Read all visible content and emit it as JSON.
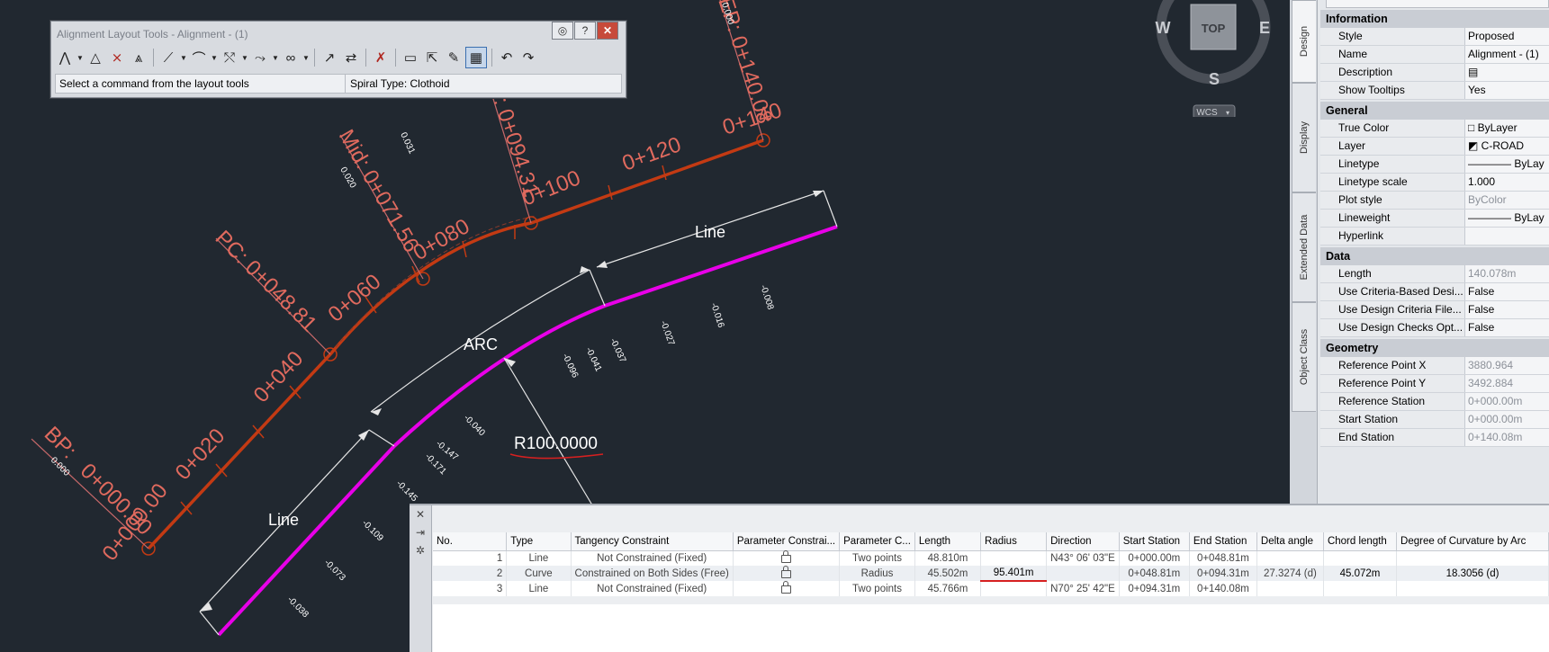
{
  "toolbar": {
    "title": "Alignment Layout Tools - Alignment - (1)",
    "status_left": "Select a command from the layout tools",
    "status_right": "Spiral Type: Clothoid",
    "close_glyph": "✕",
    "help_glyph": "?",
    "icons": [
      "pi-icon",
      "point-add-icon",
      "point-delete-icon",
      "pi-edit-icon",
      "line-tools-icon",
      "curve-tools-icon",
      "line-curve-icon",
      "spiral-tools-icon",
      "float-free-icon",
      "convert-icon",
      "reverse-icon",
      "delete-entity-icon",
      "edit-geometry-icon",
      "pick-entity-icon",
      "entity-editor-icon",
      "grid-view-icon",
      "undo-icon",
      "redo-icon"
    ]
  },
  "viewcube": {
    "top": "TOP",
    "west": "W",
    "east": "E",
    "south": "S",
    "wcs": "WCS"
  },
  "drawing": {
    "stations": {
      "s000": "0+000.00",
      "s020": "0+020",
      "s040": "0+040",
      "s060": "0+060",
      "s080": "0+080",
      "s100": "0+100",
      "s120": "0+120",
      "s140": "0+140"
    },
    "labels": {
      "bp": "BP:",
      "bp_sta": "0+000.00",
      "pc": "PC: 0+048.81",
      "mid": "Mid: 0+071.56",
      "pt": "PT: 0+094.31",
      "ep": "EP: 0+140.08",
      "line1": "Line",
      "arc": "ARC",
      "line2": "Line",
      "radius": "R100.0000"
    },
    "elev": [
      "0.000",
      "0.020",
      "0.031",
      "-0.038",
      "-0.073",
      "-0.109",
      "-0.145",
      "-0.171",
      "-0.147",
      "-0.040",
      "-0.096",
      "-0.041",
      "-0.037",
      "-0.027",
      "-0.016",
      "-0.008",
      "0.000"
    ]
  },
  "props": {
    "tabs": [
      "Design",
      "Display",
      "Extended Data",
      "Object Class"
    ],
    "sections": [
      {
        "name": "Information",
        "rows": [
          {
            "k": "Style",
            "v": "Proposed"
          },
          {
            "k": "Name",
            "v": "Alignment - (1)"
          },
          {
            "k": "Description",
            "v": "▤"
          },
          {
            "k": "Show Tooltips",
            "v": "Yes"
          }
        ]
      },
      {
        "name": "General",
        "rows": [
          {
            "k": "True Color",
            "v": "□ ByLayer"
          },
          {
            "k": "Layer",
            "v": "◩ C-ROAD"
          },
          {
            "k": "Linetype",
            "v": "———— ByLay"
          },
          {
            "k": "Linetype scale",
            "v": "1.000"
          },
          {
            "k": "Plot style",
            "v": "ByColor",
            "gray": true
          },
          {
            "k": "Lineweight",
            "v": "———— ByLay"
          },
          {
            "k": "Hyperlink",
            "v": ""
          }
        ]
      },
      {
        "name": "Data",
        "rows": [
          {
            "k": "Length",
            "v": "140.078m",
            "gray": true
          },
          {
            "k": "Use  Criteria-Based  Desi...",
            "v": "False"
          },
          {
            "k": "Use  Design  Criteria  File...",
            "v": "False"
          },
          {
            "k": "Use  Design  Checks  Opt...",
            "v": "False"
          }
        ]
      },
      {
        "name": "Geometry",
        "rows": [
          {
            "k": "Reference Point X",
            "v": "3880.964",
            "gray": true
          },
          {
            "k": "Reference Point Y",
            "v": "3492.884",
            "gray": true
          },
          {
            "k": "Reference Station",
            "v": "0+000.00m",
            "gray": true
          },
          {
            "k": "Start Station",
            "v": "0+000.00m",
            "gray": true
          },
          {
            "k": "End Station",
            "v": "0+140.08m",
            "gray": true
          }
        ]
      }
    ]
  },
  "entities": {
    "side_icons": [
      "✕",
      "⇥",
      "✲"
    ],
    "columns": [
      "No.",
      "Type",
      "Tangency Constraint",
      "Parameter Constrai...",
      "Parameter C...",
      "Length",
      "Radius",
      "Direction",
      "Start Station",
      "End Station",
      "Delta angle",
      "Chord length",
      "Degree of Curvature by Arc"
    ],
    "rows": [
      [
        "1",
        "Line",
        "Not Constrained (Fixed)",
        "lock",
        "Two points",
        "48.810m",
        "",
        "N43° 06' 03\"E",
        "0+000.00m",
        "0+048.81m",
        "",
        "",
        ""
      ],
      [
        "2",
        "Curve",
        "Constrained on Both Sides (Free)",
        "lock",
        "Radius",
        "45.502m",
        "95.401m",
        "",
        "0+048.81m",
        "0+094.31m",
        "27.3274 (d)",
        "45.072m",
        "18.3056 (d)"
      ],
      [
        "3",
        "Line",
        "Not Constrained (Fixed)",
        "lock",
        "Two points",
        "45.766m",
        "",
        "N70° 25' 42\"E",
        "0+094.31m",
        "0+140.08m",
        "",
        "",
        ""
      ]
    ]
  }
}
